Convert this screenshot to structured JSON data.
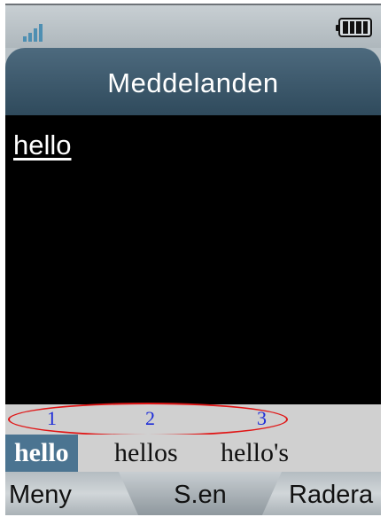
{
  "status": {
    "signal_icon": "signal-strength-icon",
    "battery_icon": "battery-full-icon"
  },
  "header": {
    "title": "Meddelanden"
  },
  "message": {
    "text": "hello"
  },
  "prediction": {
    "numbers": [
      "1",
      "2",
      "3"
    ],
    "suggestions": [
      "hello",
      "hellos",
      "hello's"
    ],
    "selected_index": 0
  },
  "softkeys": {
    "left": "Meny",
    "center": "S.en",
    "right": "Radera"
  },
  "colors": {
    "title_bar": "#3c586b",
    "selected_suggestion": "#4b7491",
    "annotation_ring": "#e01515",
    "number_text": "#1d2cd8"
  }
}
